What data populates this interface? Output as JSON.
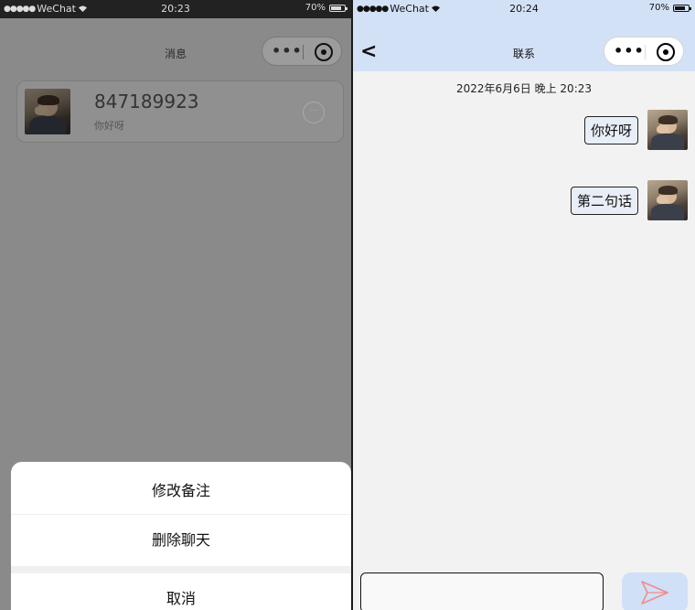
{
  "left_screen": {
    "status_bar": {
      "signal": "●●●●●",
      "carrier": "WeChat",
      "time": "20:23",
      "battery_pct": "70%",
      "battery_level": 0.7
    },
    "nav": {
      "title": "消息",
      "more_glyph": "•••"
    },
    "chat_item": {
      "name": "847189923",
      "preview": "你好呀",
      "more_glyph": "···"
    },
    "action_sheet": {
      "items": [
        "修改备注",
        "删除聊天"
      ],
      "cancel": "取消"
    }
  },
  "right_screen": {
    "status_bar": {
      "signal": "●●●●●",
      "carrier": "WeChat",
      "time": "20:24",
      "battery_pct": "70%",
      "battery_level": 0.7
    },
    "nav": {
      "back_glyph": "<",
      "title": "联系",
      "more_glyph": "•••"
    },
    "timestamp": "2022年6月6日 晚上 20:23",
    "messages": [
      {
        "text": "你好呀",
        "sender": "self"
      },
      {
        "text": "第二句话",
        "sender": "self"
      }
    ],
    "input": {
      "value": "",
      "placeholder": ""
    }
  },
  "colors": {
    "right_header_bg": "#d3e1f7",
    "send_button_bg": "#cfe0f7",
    "send_icon": "#f28b8b",
    "dim_overlay": "#8a8a8a"
  },
  "icons": [
    "wifi-icon",
    "battery-icon",
    "more-icon",
    "target-icon",
    "back-icon",
    "send-icon",
    "avatar-image"
  ]
}
